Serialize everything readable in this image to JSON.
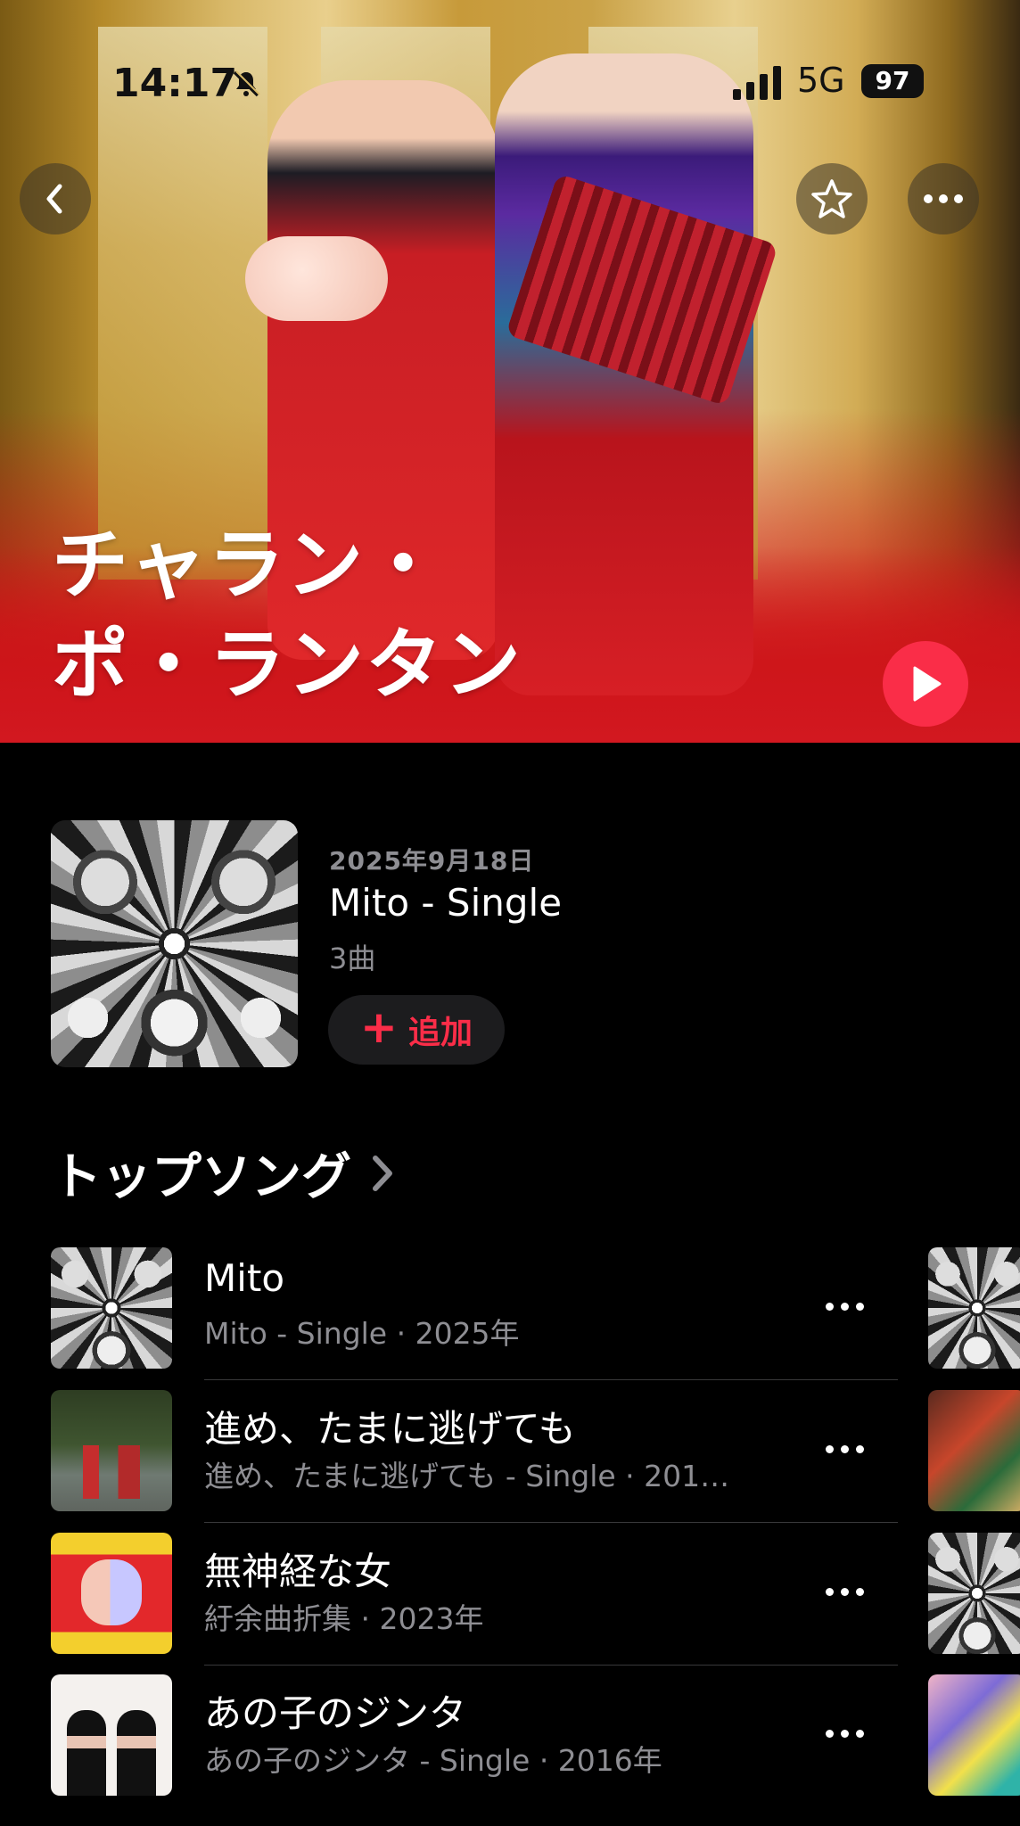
{
  "status_bar": {
    "time": "14:17",
    "network": "5G",
    "battery": "97",
    "icons": [
      "bell-slash-icon",
      "signal-bars-icon"
    ]
  },
  "hero": {
    "artist_name_line1": "チャラン・",
    "artist_name_line2": "ポ・ランタン",
    "icons": [
      "back-chevron-icon",
      "star-icon",
      "ellipsis-icon",
      "play-icon"
    ]
  },
  "latest_release": {
    "date": "2025年9月18日",
    "title": "Mito - Single",
    "track_count": "3曲",
    "add_label": "追加",
    "add_icon": "plus-icon"
  },
  "top_songs": {
    "heading": "トップソング",
    "heading_icon": "chevron-right-icon",
    "items": [
      {
        "title": "Mito",
        "subtitle": "Mito - Single · 2025年",
        "art": "mito-cover"
      },
      {
        "title": "進め、たまに逃げても",
        "subtitle": "進め、たまに逃げても - Single · 201…",
        "art": "susume-cover"
      },
      {
        "title": "無神経な女",
        "subtitle": "紆余曲折集 · 2023年",
        "art": "uyokyokusetsu-cover"
      },
      {
        "title": "あの子のジンタ",
        "subtitle": "あの子のジンタ - Single · 2016年",
        "art": "anoko-cover"
      }
    ]
  },
  "colors": {
    "accent": "#fa2d48",
    "background": "#000000",
    "secondary_text": "#8e8e93",
    "hero_red": "#d5151c"
  }
}
